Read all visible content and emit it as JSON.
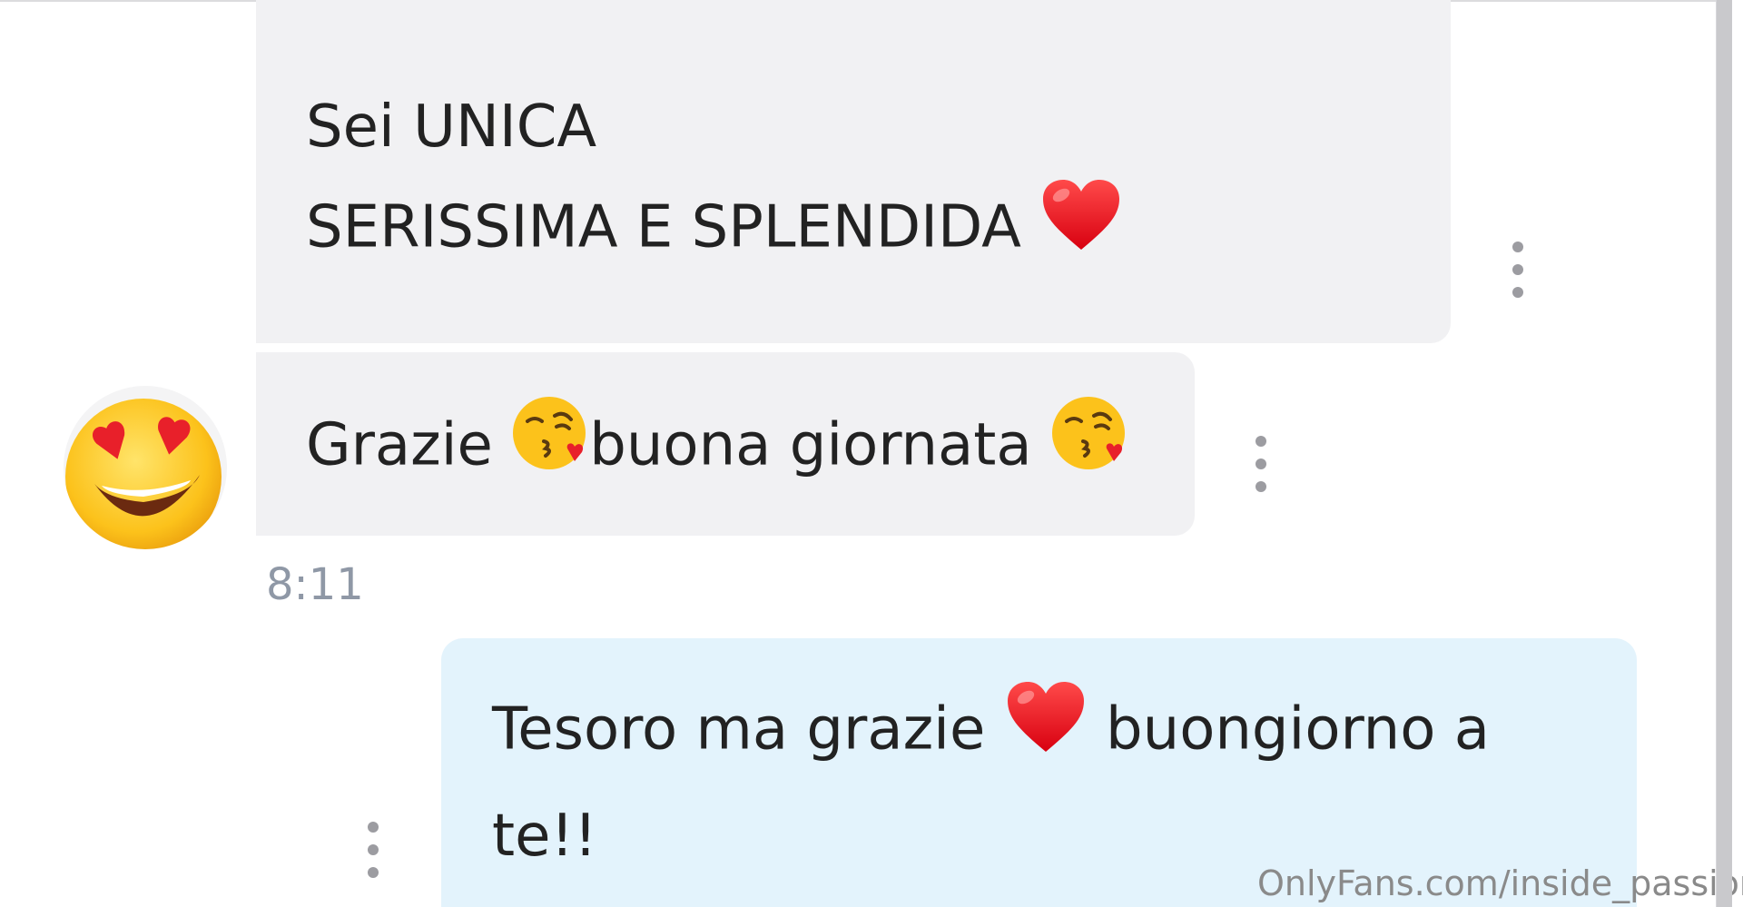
{
  "chat": {
    "messages": [
      {
        "direction": "incoming",
        "lines": [
          "Sei UNICA",
          "SERISSIMA E SPLENDIDA"
        ],
        "emoji": [
          "red-heart"
        ]
      },
      {
        "direction": "incoming",
        "parts": [
          "Grazie ",
          "buona giornata "
        ],
        "emoji": [
          "face-blowing-kiss",
          "face-blowing-kiss"
        ]
      },
      {
        "direction": "outgoing",
        "parts": [
          "Tesoro ma grazie ",
          " buongiorno a te!!"
        ],
        "emoji": [
          "red-heart"
        ]
      }
    ],
    "timestamp": "8:11",
    "avatar_emoji": "smiling-face-with-heart-eyes"
  },
  "watermark": "OnlyFans.com/inside_passion",
  "colors": {
    "incoming_bubble": "#f1f1f3",
    "outgoing_bubble": "#e3f3fc",
    "text": "#222222",
    "timestamp": "#8f98a6",
    "more_dots": "#9c9ca1"
  },
  "icons": {
    "more": "more-vertical-icon"
  }
}
